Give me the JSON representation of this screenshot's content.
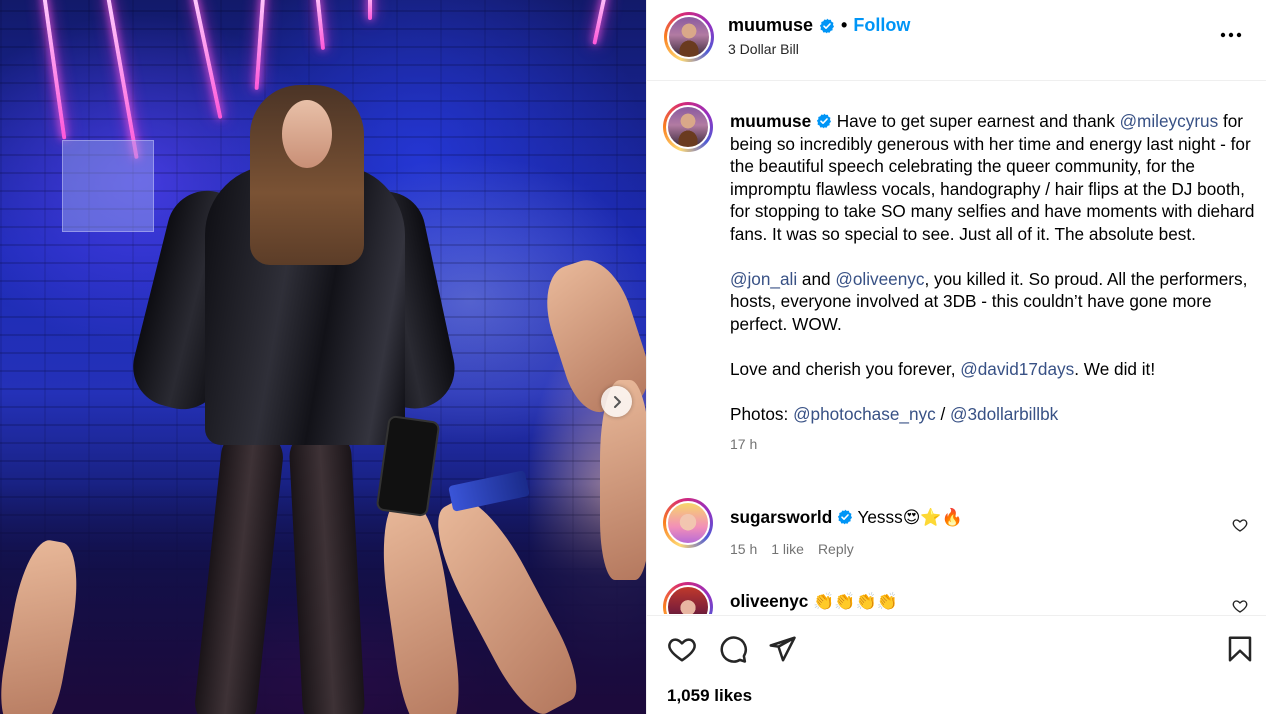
{
  "post": {
    "username": "muumuse",
    "follow_label": "Follow",
    "separator": "•",
    "subtitle": "3 Dollar Bill",
    "more_label": "•••",
    "caption": {
      "username": "muumuse",
      "p1_before": "Have to get super earnest and thank ",
      "p1_mention": "@mileycyrus",
      "p1_after": " for being so incredibly generous with her time and energy last night - for the beautiful speech celebrating the queer community, for the impromptu flawless vocals, handography / hair flips at the DJ booth, for stopping to take SO many selfies and have moments with diehard fans. It was so special to see. Just all of it. The absolute best.",
      "p2_mention1": "@jon_ali",
      "p2_and": " and ",
      "p2_mention2": "@oliveenyc",
      "p2_after": ", you killed it. So proud. All the performers, hosts, everyone involved at 3DB - this couldn’t have gone more perfect. WOW.",
      "p3_before": "Love and cherish you forever, ",
      "p3_mention": "@david17days",
      "p3_after": ". We did it!",
      "p4_before": "Photos: ",
      "p4_mention1": "@photochase_nyc",
      "p4_sep": " / ",
      "p4_mention2": "@3dollarbillbk",
      "time": "17 h"
    },
    "comments": [
      {
        "username": "sugarsworld",
        "text": "Yesss",
        "emojis": "😍⭐🔥",
        "time": "15 h",
        "likes": "1 like",
        "reply": "Reply"
      },
      {
        "username": "oliveenyc",
        "text": "",
        "emojis": "👏👏👏👏"
      }
    ],
    "likes": "1,059 likes"
  },
  "icons": {
    "verified": "verified-badge-icon",
    "more": "more-options-icon",
    "next": "chevron-right-icon",
    "like": "heart-icon",
    "comment": "comment-bubble-icon",
    "share": "paper-plane-icon",
    "save": "bookmark-icon"
  },
  "colors": {
    "accent": "#0095f6",
    "mention": "#385185",
    "muted": "#737373",
    "verified": "#0095f6"
  }
}
